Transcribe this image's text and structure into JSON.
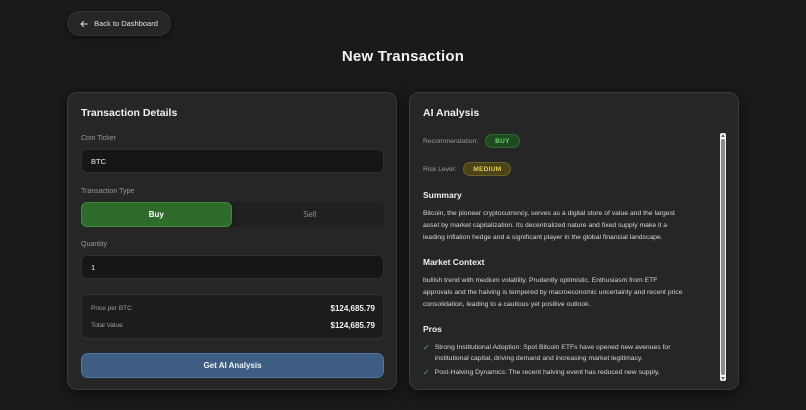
{
  "nav": {
    "back_label": "Back to Dashboard",
    "back_icon": "arrow-left-icon"
  },
  "page": {
    "title": "New Transaction"
  },
  "details": {
    "title": "Transaction Details",
    "coin_ticker_label": "Coin Ticker",
    "coin_ticker_value": "BTC",
    "type_label": "Transaction Type",
    "type_options": [
      "Buy",
      "Sell"
    ],
    "type_selected": "Buy",
    "quantity_label": "Quantity",
    "quantity_value": "1",
    "price_label": "Price per BTC",
    "price_value": "$124,685.79",
    "total_label": "Total Value",
    "total_value": "$124,685.79",
    "ai_button_label": "Get AI Analysis"
  },
  "analysis": {
    "title": "AI Analysis",
    "recommendation_label": "Recommendation:",
    "recommendation_value": "BUY",
    "risk_label": "Risk Level:",
    "risk_value": "MEDIUM",
    "summary_title": "Summary",
    "summary_lines": [
      "Bitcoin, the pioneer cryptocurrency, serves as a digital store of value and the largest",
      "asset by market capitalization. Its decentralized nature and fixed supply make it a",
      "leading inflation hedge and a significant player in the global financial landscape."
    ],
    "context_title": "Market Context",
    "context_lines": [
      "bullish trend with medium volatility. Prudently optimistic. Enthusiasm from ETF",
      "approvals and the halving is tempered by macroeconomic uncertainty and recent price",
      "consolidation, leading to a cautious yet positive outlook."
    ],
    "pros_title": "Pros",
    "pros": [
      {
        "line1": "Strong Institutional Adoption: Spot Bitcoin ETFs have opened new avenues for",
        "line2": "institutional capital, driving demand and increasing market legitimacy."
      },
      {
        "line1": "Post-Halving Dynamics: The recent halving event has reduced new supply,",
        "line2": ""
      }
    ]
  },
  "colors": {
    "background": "#1a1a1a",
    "card": "#262626",
    "buy_active": "#2f6b2a",
    "ai_button": "#3d5e82",
    "badge_buy": "#6fd36a",
    "badge_medium": "#e6cf52"
  }
}
